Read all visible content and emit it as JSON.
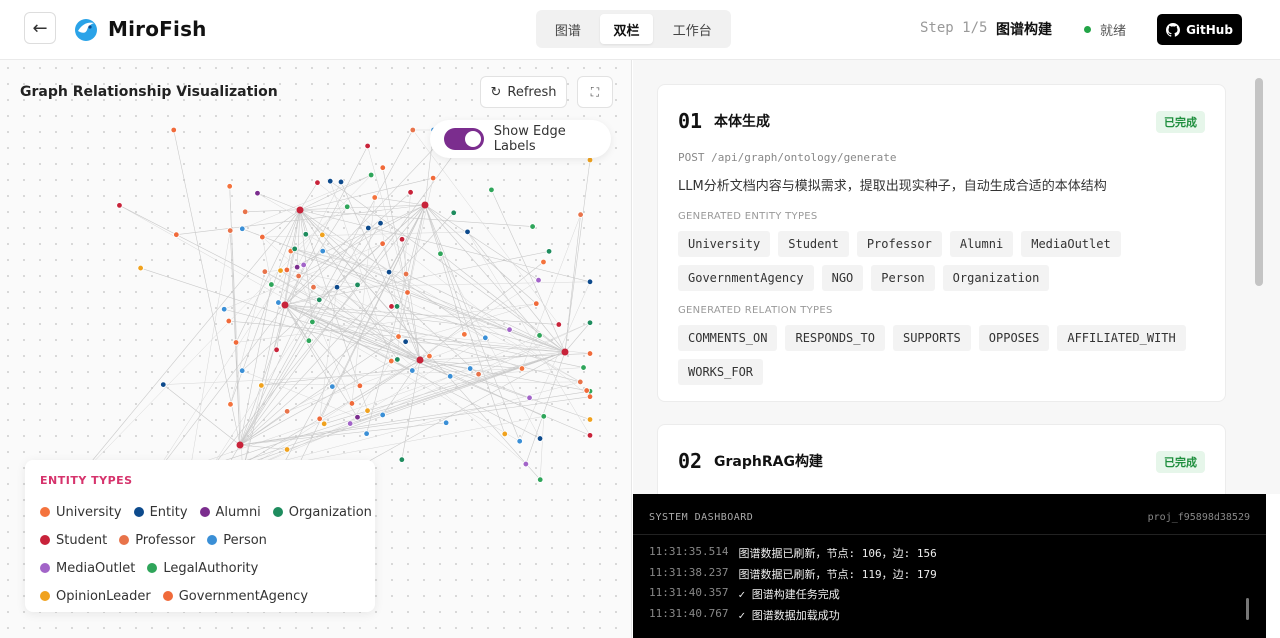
{
  "header": {
    "brand": "MiroFish",
    "tabs": [
      "图谱",
      "双栏",
      "工作台"
    ],
    "step_label": "Step 1/5",
    "step_title": "图谱构建",
    "status": "就绪",
    "github": "GitHub"
  },
  "graph": {
    "title": "Graph Relationship Visualization",
    "refresh": "Refresh",
    "edge_labels_toggle": "Show Edge Labels",
    "edge_labels_on": true
  },
  "legend": {
    "title": "ENTITY TYPES",
    "rows": [
      [
        {
          "label": "University",
          "color": "#f4733d"
        },
        {
          "label": "Entity",
          "color": "#0d4a8c"
        },
        {
          "label": "Alumni",
          "color": "#7b2d8e"
        },
        {
          "label": "Organization",
          "color": "#1e8c5e"
        }
      ],
      [
        {
          "label": "Student",
          "color": "#c8233a"
        },
        {
          "label": "Professor",
          "color": "#e8734a"
        },
        {
          "label": "Person",
          "color": "#3a8fd6"
        }
      ],
      [
        {
          "label": "MediaOutlet",
          "color": "#a264c8"
        },
        {
          "label": "LegalAuthority",
          "color": "#2fa55a"
        }
      ],
      [
        {
          "label": "OpinionLeader",
          "color": "#f0a21e"
        },
        {
          "label": "GovernmentAgency",
          "color": "#f06a3a"
        }
      ]
    ]
  },
  "steps": [
    {
      "num": "01",
      "title": "本体生成",
      "badge": "已完成",
      "endpoint": "POST /api/graph/ontology/generate",
      "desc": "LLM分析文档内容与模拟需求，提取出现实种子，自动生成合适的本体结构",
      "entity_label": "GENERATED ENTITY TYPES",
      "entity_types": [
        "University",
        "Student",
        "Professor",
        "Alumni",
        "MediaOutlet",
        "GovernmentAgency",
        "NGO",
        "Person",
        "Organization"
      ],
      "relation_label": "GENERATED RELATION TYPES",
      "relation_types": [
        "COMMENTS_ON",
        "RESPONDS_TO",
        "SUPPORTS",
        "OPPOSES",
        "AFFILIATED_WITH",
        "WORKS_FOR"
      ]
    },
    {
      "num": "02",
      "title": "GraphRAG构建",
      "badge": "已完成"
    }
  ],
  "dashboard": {
    "title": "SYSTEM DASHBOARD",
    "project": "proj_f95898d38529",
    "logs": [
      {
        "time": "11:31:35.514",
        "msg": "图谱数据已刷新，节点: 106，边: 156"
      },
      {
        "time": "11:31:38.237",
        "msg": "图谱数据已刷新，节点: 119，边: 179"
      },
      {
        "time": "11:31:40.357",
        "msg": "✓ 图谱构建任务完成"
      },
      {
        "time": "11:31:40.767",
        "msg": "✓ 图谱数据加载成功"
      }
    ]
  }
}
